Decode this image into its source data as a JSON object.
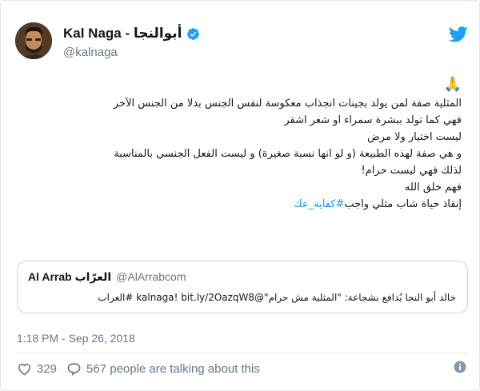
{
  "tweet": {
    "author": {
      "display_name": "Kal Naga - أبوالنجا",
      "handle": "@kalnaga"
    },
    "emoji": "🙏",
    "lines": [
      "المثلية صفة لمن يولد بجينات انجذاب معكوسة لنفس الجنس بدلا من الجنس الآخر",
      "فهي كما تولد ببشرة سمراء او شعر اشقر",
      "ليست اختيار ولا مرض",
      "و هي صفة لهذه الطبيعة (و لو انها نسبة صغيرة) و ليست الفعل الجنسي بالمناسبة",
      "لذلك فهي ليست حرام!",
      "فهم خلق الله"
    ],
    "last_line_text": "إنقاذ حياة شاب مثلي واجب",
    "hashtag": "#كفاية_عك",
    "quoted": {
      "name": "Al Arrab العرّاب",
      "handle": "@AlArrabcom",
      "text": "خالد أبو النجا يُدافع بشجاعة: \"المثلية مش حرام\"@kalnaga! bit.ly/2OazqW8 #العراب"
    },
    "timestamp": "1:18 PM - Sep 26, 2018",
    "likes": "329",
    "replies_label": "567 people are talking about this"
  },
  "icons": {
    "brand": "twitter-bird-icon",
    "verified": "verified-badge-icon",
    "like": "heart-icon",
    "reply": "speech-bubble-icon",
    "info": "info-icon"
  },
  "colors": {
    "accent": "#1da1f2",
    "link": "#1b95e0",
    "muted": "#657786",
    "text": "#14171a"
  }
}
